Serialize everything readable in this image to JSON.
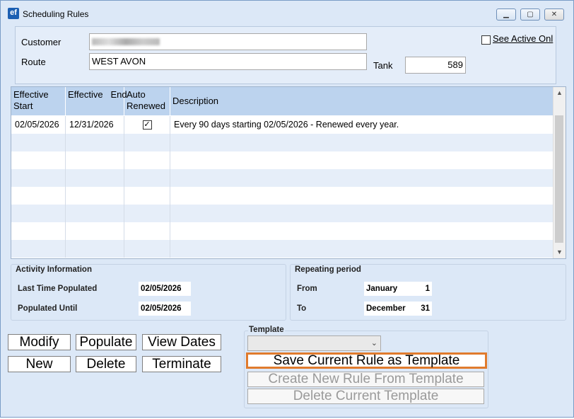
{
  "window": {
    "title": "Scheduling Rules",
    "icon_text": "ef",
    "controls": {
      "minimize_icon": "minimize-icon",
      "maximize_icon": "maximize-icon",
      "close_icon": "close-icon"
    }
  },
  "form": {
    "customer_label": "Customer",
    "customer_value": "",
    "route_label": "Route",
    "route_value": "WEST AVON",
    "tank_label": "Tank",
    "tank_value": "589",
    "see_active_label": "See Active Onl",
    "see_active_checked": false
  },
  "grid": {
    "columns": [
      {
        "line1": "Effective",
        "line2": "Start"
      },
      {
        "line1": "Effective   End",
        "line2": ""
      },
      {
        "line1": "Auto",
        "line2": "Renewed"
      },
      {
        "line1": "Description",
        "line2": ""
      }
    ],
    "rows": [
      {
        "start": "02/05/2026",
        "end": "12/31/2026",
        "auto_renewed": true,
        "description": "Every 90 days starting 02/05/2026 - Renewed every year."
      }
    ]
  },
  "activity": {
    "title": "Activity Information",
    "last_populated_label": "Last Time Populated",
    "last_populated_value": "02/05/2026",
    "populated_until_label": "Populated Until",
    "populated_until_value": "02/05/2026"
  },
  "repeating": {
    "title": "Repeating period",
    "from_label": "From",
    "from_month": "January",
    "from_day": "1",
    "to_label": "To",
    "to_month": "December",
    "to_day": "31"
  },
  "buttons": {
    "modify": "Modify",
    "populate": "Populate",
    "view_dates": "View Dates",
    "new": "New",
    "delete": "Delete",
    "terminate": "Terminate"
  },
  "template": {
    "title": "Template",
    "selected": "",
    "save_label": "Save Current Rule as Template",
    "create_label": "Create New Rule From Template",
    "delete_label": "Delete Current Template"
  },
  "colors": {
    "accent": "#e07b2d",
    "header": "#bcd3ee",
    "window_bg": "#dce8f7"
  }
}
